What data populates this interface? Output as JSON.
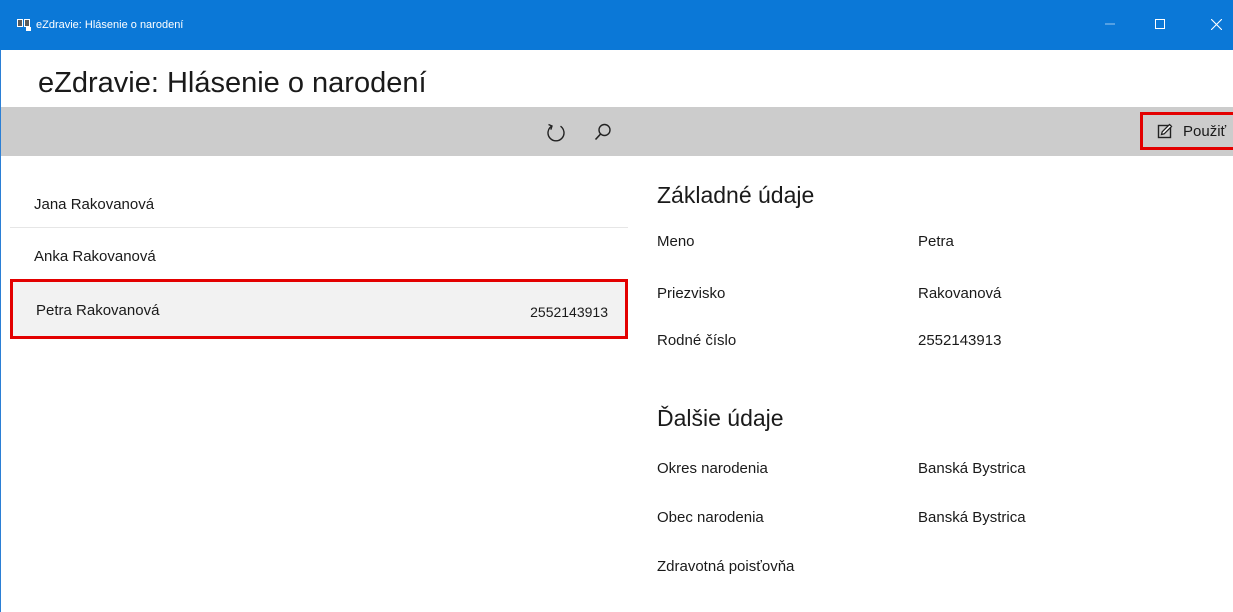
{
  "window": {
    "title": "eZdravie: Hlásenie o narodení",
    "accent": "#0b78d7"
  },
  "header": {
    "title": "eZdravie: Hlásenie o narodení"
  },
  "toolbar": {
    "refresh_icon": "refresh-icon",
    "search_icon": "search-icon",
    "use_label": "Použiť",
    "use_icon": "edit-icon"
  },
  "list": {
    "items": [
      {
        "name": "Jana Rakovanová",
        "rc": ""
      },
      {
        "name": "Anka Rakovanová",
        "rc": ""
      },
      {
        "name": "Petra Rakovanová",
        "rc": "2552143913"
      }
    ],
    "highlight_color": "#e30000"
  },
  "details": {
    "basic": {
      "title": "Základné údaje",
      "fields": [
        {
          "label": "Meno",
          "value": "Petra"
        },
        {
          "label": "Priezvisko",
          "value": "Rakovanová"
        },
        {
          "label": "Rodné číslo",
          "value": "2552143913"
        }
      ]
    },
    "other": {
      "title": "Ďalšie údaje",
      "fields": [
        {
          "label": "Okres narodenia",
          "value": "Banská Bystrica"
        },
        {
          "label": "Obec narodenia",
          "value": "Banská Bystrica"
        },
        {
          "label": "Zdravotná poisťovňa",
          "value": ""
        }
      ]
    }
  }
}
